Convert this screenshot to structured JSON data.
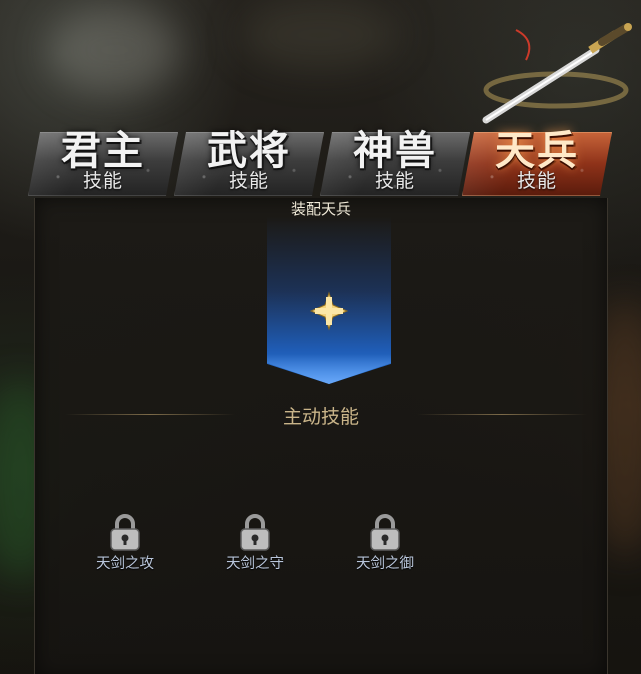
{
  "tabs": [
    {
      "title": "君主",
      "subtitle": "技能",
      "active": false
    },
    {
      "title": "武将",
      "subtitle": "技能",
      "active": false
    },
    {
      "title": "神兽",
      "subtitle": "技能",
      "active": false
    },
    {
      "title": "天兵",
      "subtitle": "技能",
      "active": true
    }
  ],
  "panel": {
    "equip_label": "装配天兵",
    "section_title": "主动技能"
  },
  "skills": [
    {
      "name": "天剑之攻",
      "locked": true
    },
    {
      "name": "天剑之守",
      "locked": true
    },
    {
      "name": "天剑之御",
      "locked": true
    }
  ],
  "icons": {
    "slot": "plus-icon",
    "skill": "lock-icon",
    "decoration": "sword-icon"
  },
  "colors": {
    "active_tab": "#8e3219",
    "banner": "#1f5cb5",
    "plus": "#f3d27a",
    "section_text": "#c9b489"
  }
}
